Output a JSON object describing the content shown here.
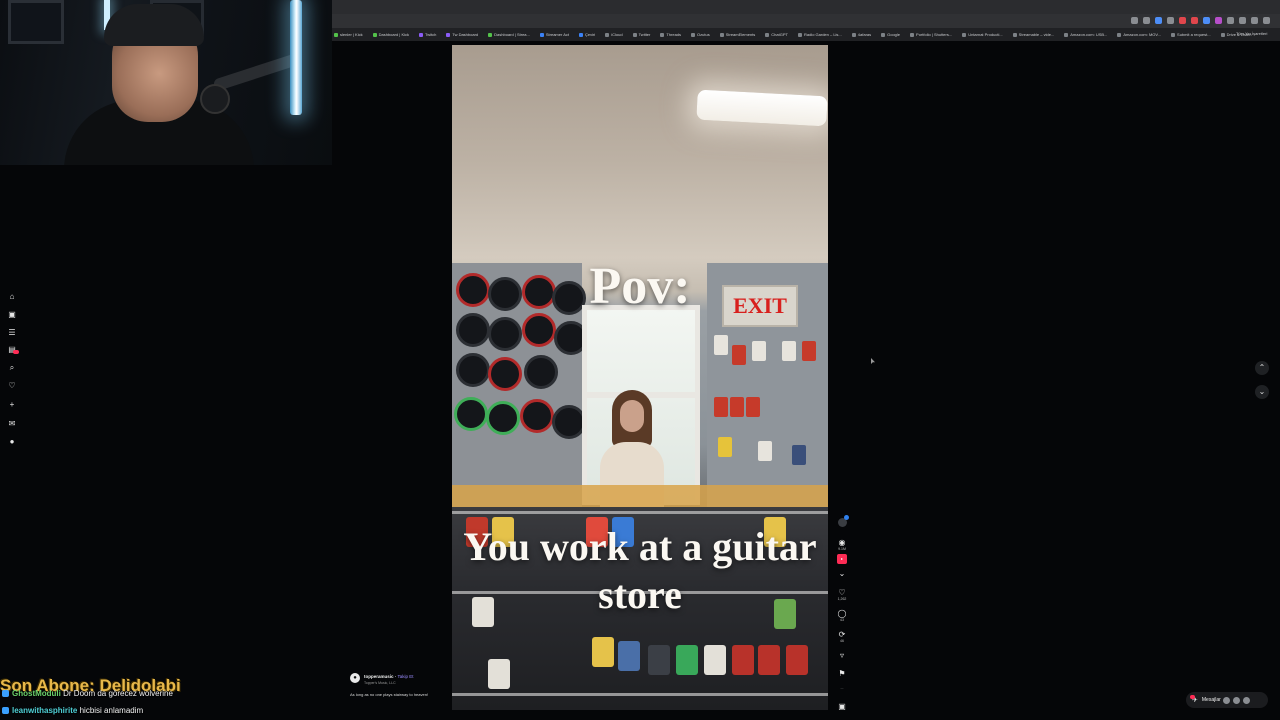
{
  "browser": {
    "bookmarks": [
      {
        "label": "slenler | Kick",
        "icon": "green-square"
      },
      {
        "label": "Dashboard | Kick",
        "icon": "green-square"
      },
      {
        "label": "Twitch",
        "icon": "purple-square"
      },
      {
        "label": "Tw Dashboard",
        "icon": "purple-square"
      },
      {
        "label": "Dashboard | Strea...",
        "icon": "green-square"
      },
      {
        "label": "Streamer Act",
        "icon": "blue-square"
      },
      {
        "label": "Çeviri",
        "icon": "blue-square"
      },
      {
        "label": "iCloud",
        "icon": "gray-square"
      },
      {
        "label": "Twitter",
        "icon": "gray-square"
      },
      {
        "label": "Threads",
        "icon": "gray-square"
      },
      {
        "label": "Ozutus",
        "icon": "gray-square"
      },
      {
        "label": "StreamElements",
        "icon": "gray-square"
      },
      {
        "label": "ChatGPT",
        "icon": "gray-square"
      },
      {
        "label": "Radio Garden – Lis...",
        "icon": "gray-square"
      },
      {
        "label": "4afaras",
        "icon": "gray-square"
      },
      {
        "label": "Google",
        "icon": "gray-square"
      },
      {
        "label": "Portfolio | Shutters...",
        "icon": "gray-square"
      },
      {
        "label": "Untarnat Producti...",
        "icon": "gray-square"
      },
      {
        "label": "Streamable – vide...",
        "icon": "gray-square"
      },
      {
        "label": "Amazon.com: USB...",
        "icon": "gray-square"
      },
      {
        "label": "Amazon.com: MOV...",
        "icon": "gray-square"
      },
      {
        "label": "Submit a request...",
        "icon": "gray-square"
      },
      {
        "label": "Drive & Listen",
        "icon": "gray-square"
      }
    ],
    "bookmarks_end": "Tüm Yer İşaretleri"
  },
  "left_nav": [
    {
      "name": "home",
      "glyph": "⌂"
    },
    {
      "name": "explore",
      "glyph": "▣"
    },
    {
      "name": "following",
      "glyph": "☰"
    },
    {
      "name": "live",
      "glyph": "▤"
    },
    {
      "name": "search",
      "glyph": "⌕"
    },
    {
      "name": "favorites",
      "glyph": "♡"
    },
    {
      "name": "upload",
      "glyph": "+"
    },
    {
      "name": "inbox",
      "glyph": "✉"
    },
    {
      "name": "profile",
      "glyph": "●"
    }
  ],
  "video": {
    "caption_line1": "Pov:",
    "caption_line2": "You work at a guitar store",
    "sign_text": "EXIT",
    "author": "topperamusic",
    "follow_label": "Takip Et",
    "location": "Topper's Music, LLC",
    "description": "As long as no one plays stairway to heaven!"
  },
  "actions": {
    "live_count": "9.1M",
    "likes": "1,262",
    "comments": "43",
    "reposts": "46",
    "shares": "..."
  },
  "messages": {
    "label": "Mesajlar"
  },
  "overlay": {
    "sub_label": "Son Abone: Delidolabi",
    "chat": [
      {
        "user": "GhostModuli",
        "message": "Dr Doom da görecez wolverine"
      },
      {
        "user": "leanwithasphirite",
        "message": "hicbisi anlamadim"
      }
    ]
  }
}
